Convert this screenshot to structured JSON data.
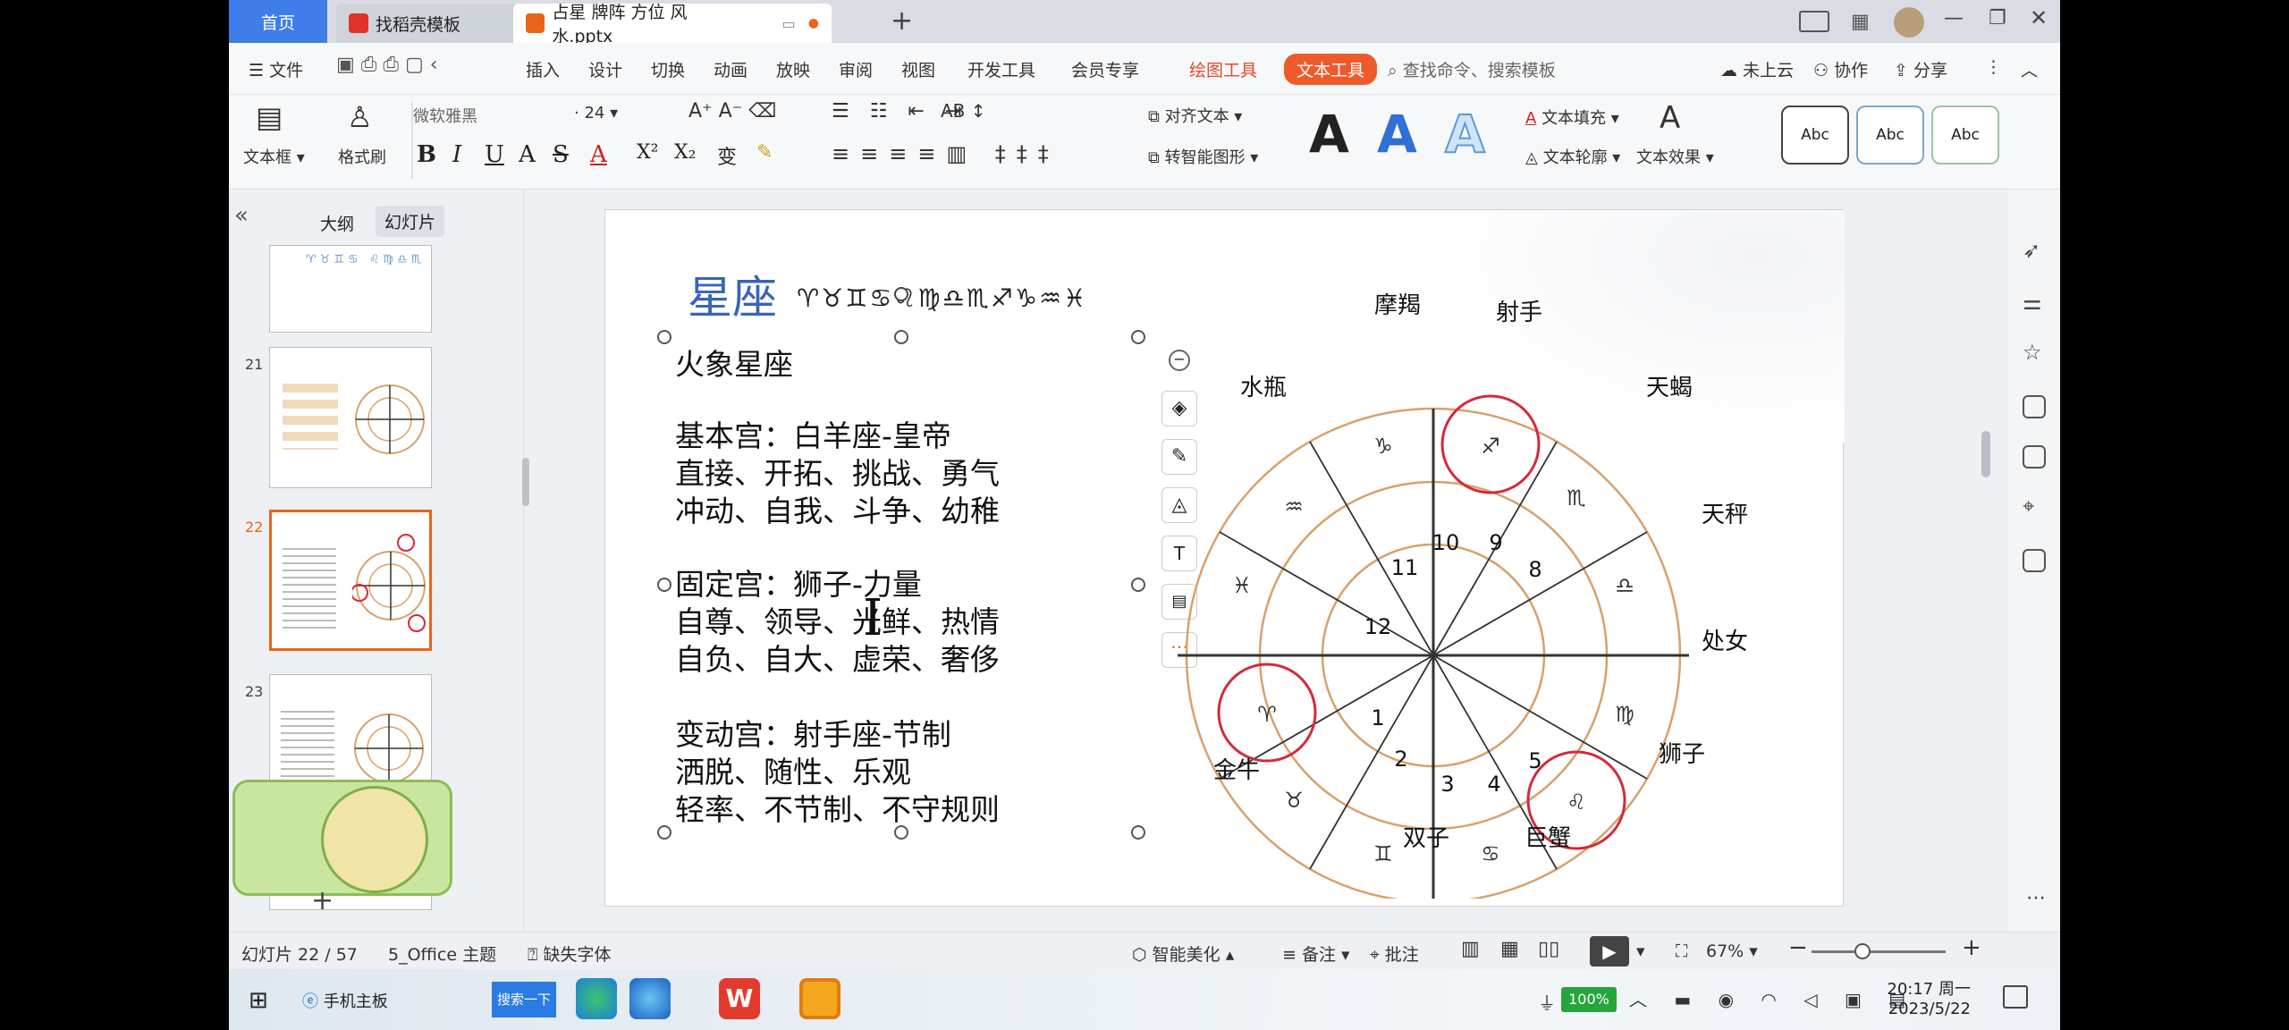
{
  "tabs": {
    "home": "首页",
    "template": "找稻壳模板",
    "doc": "占星 牌阵 方位 风水.pptx"
  },
  "menubar": {
    "file": "文件",
    "items": [
      "插入",
      "设计",
      "切换",
      "动画",
      "放映",
      "审阅",
      "视图",
      "开发工具",
      "会员专享",
      "绘图工具",
      "文本工具"
    ],
    "search_placeholder": "查找命令、搜索模板",
    "cloud": "未上云",
    "collab": "协作",
    "share": "分享"
  },
  "ribbon": {
    "textbox": "文本框",
    "format_painter": "格式刷",
    "font_name": "微软雅黑",
    "font_size": "24",
    "align_text": "对齐文本",
    "smart_shape": "转智能图形",
    "text_fill": "文本填充",
    "text_outline": "文本轮廓",
    "text_effect": "文本效果",
    "style_labels": [
      "Abc",
      "Abc",
      "Abc"
    ],
    "big_a": [
      "A",
      "A",
      "A"
    ],
    "colors": {
      "big_a_1": "#111111",
      "big_a_2": "#2f6fd6",
      "big_a_3": "#7fb6e6",
      "text_fill_red": "#d02020"
    }
  },
  "leftpanel": {
    "tab_outline": "大纲",
    "tab_slides": "幻灯片",
    "slides": [
      {
        "num": "21"
      },
      {
        "num": "22",
        "selected": true
      },
      {
        "num": "23"
      }
    ]
  },
  "slide": {
    "title": "星座",
    "symbols": "♈♉♊♋♌♍♎♏♐♑♒♓",
    "body": [
      "火象星座",
      "",
      "基本宫：白羊座-皇帝",
      "直接、开拓、挑战、勇气",
      "冲动、自我、斗争、幼稚",
      "",
      "固定宫：狮子-力量",
      "自尊、领导、光鲜、热情",
      "自负、自大、虚荣、奢侈",
      "",
      "变动宫：射手座-节制",
      "洒脱、随性、乐观",
      "轻率、不节制、不守规则"
    ],
    "zodiac_labels": {
      "capricorn": "摩羯",
      "sagittarius": "射手",
      "aquarius": "水瓶",
      "scorpio": "天蝎",
      "libra": "天秤",
      "virgo": "处女",
      "leo": "狮子",
      "cancer": "巨蟹",
      "gemini": "双子",
      "taurus": "金牛"
    },
    "house_numbers": [
      "1",
      "2",
      "3",
      "4",
      "5",
      "8",
      "9",
      "10",
      "11",
      "12"
    ],
    "zodiac_glyphs": [
      "♈",
      "♉",
      "♊",
      "♋",
      "♌",
      "♍",
      "♎",
      "♏",
      "♐",
      "♑",
      "♒",
      "♓"
    ],
    "colors": {
      "title": "#3a64b8",
      "ring": "#d9a06a",
      "highlight": "#d42a3a"
    }
  },
  "status": {
    "slide_count": "幻灯片 22 / 57",
    "theme": "5_Office 主题",
    "missing_font": "缺失字体",
    "beautify": "智能美化",
    "notes": "备注",
    "comments": "批注",
    "zoom": "67%"
  },
  "taskbar": {
    "ie_label": "手机主板",
    "search_btn": "搜索一下",
    "battery": "100%",
    "time": "20:17 周一",
    "date": "2023/5/22"
  }
}
